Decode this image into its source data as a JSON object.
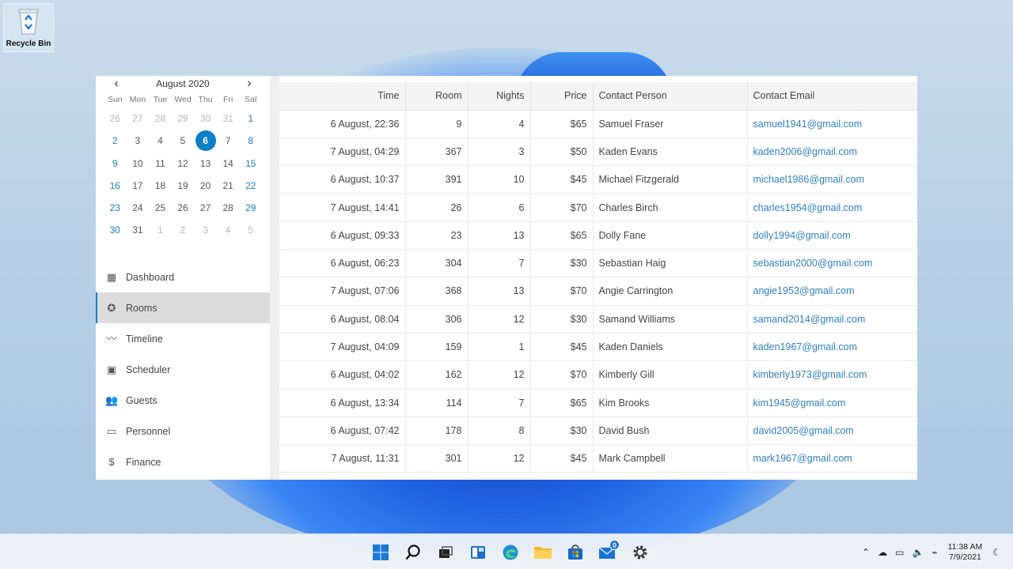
{
  "desktop": {
    "recycle_bin_label": "Recycle Bin"
  },
  "calendar": {
    "month_label": "August 2020",
    "weekdays": [
      "Sun",
      "Mon",
      "Tue",
      "Wed",
      "Thu",
      "Fri",
      "Sat"
    ],
    "weeks": [
      [
        [
          "26",
          "other"
        ],
        [
          "27",
          "other"
        ],
        [
          "28",
          "other"
        ],
        [
          "29",
          "other"
        ],
        [
          "30",
          "other"
        ],
        [
          "31",
          "other"
        ],
        [
          "1",
          "weekend"
        ]
      ],
      [
        [
          "2",
          "weekend"
        ],
        [
          "3",
          ""
        ],
        [
          "4",
          ""
        ],
        [
          "5",
          ""
        ],
        [
          "6",
          "sel"
        ],
        [
          "7",
          ""
        ],
        [
          "8",
          "weekend"
        ]
      ],
      [
        [
          "9",
          "weekend"
        ],
        [
          "10",
          ""
        ],
        [
          "11",
          ""
        ],
        [
          "12",
          ""
        ],
        [
          "13",
          ""
        ],
        [
          "14",
          ""
        ],
        [
          "15",
          "weekend"
        ]
      ],
      [
        [
          "16",
          "weekend"
        ],
        [
          "17",
          ""
        ],
        [
          "18",
          ""
        ],
        [
          "19",
          ""
        ],
        [
          "20",
          ""
        ],
        [
          "21",
          ""
        ],
        [
          "22",
          "weekend"
        ]
      ],
      [
        [
          "23",
          "weekend"
        ],
        [
          "24",
          ""
        ],
        [
          "25",
          ""
        ],
        [
          "26",
          ""
        ],
        [
          "27",
          ""
        ],
        [
          "28",
          ""
        ],
        [
          "29",
          "weekend"
        ]
      ],
      [
        [
          "30",
          "weekend"
        ],
        [
          "31",
          ""
        ],
        [
          "1",
          "other"
        ],
        [
          "2",
          "other"
        ],
        [
          "3",
          "other"
        ],
        [
          "4",
          "other"
        ],
        [
          "5",
          "other"
        ]
      ]
    ]
  },
  "menu": [
    {
      "label": "Dashboard",
      "icon": "dashboard-icon",
      "glyph": "▦"
    },
    {
      "label": "Rooms",
      "icon": "rooms-icon",
      "glyph": "✪",
      "active": true
    },
    {
      "label": "Timeline",
      "icon": "timeline-icon",
      "glyph": "〰"
    },
    {
      "label": "Scheduler",
      "icon": "scheduler-icon",
      "glyph": "▣"
    },
    {
      "label": "Guests",
      "icon": "guests-icon",
      "glyph": "👥"
    },
    {
      "label": "Personnel",
      "icon": "personnel-icon",
      "glyph": "▭"
    },
    {
      "label": "Finance",
      "icon": "finance-icon",
      "glyph": "$"
    }
  ],
  "table": {
    "headers": [
      "Time",
      "Room",
      "Nights",
      "Price",
      "Contact Person",
      "Contact Email"
    ],
    "rows": [
      [
        "6 August, 22:36",
        "9",
        "4",
        "$65",
        "Samuel Fraser",
        "samuel1941@gmail.com"
      ],
      [
        "7 August, 04:29",
        "367",
        "3",
        "$50",
        "Kaden Evans",
        "kaden2006@gmail.com"
      ],
      [
        "6 August, 10:37",
        "391",
        "10",
        "$45",
        "Michael Fitzgerald",
        "michael1986@gmail.com"
      ],
      [
        "7 August, 14:41",
        "26",
        "6",
        "$70",
        "Charles Birch",
        "charles1954@gmail.com"
      ],
      [
        "6 August, 09:33",
        "23",
        "13",
        "$65",
        "Dolly Fane",
        "dolly1994@gmail.com"
      ],
      [
        "6 August, 06:23",
        "304",
        "7",
        "$30",
        "Sebastian Haig",
        "sebastian2000@gmail.com"
      ],
      [
        "7 August, 07:06",
        "368",
        "13",
        "$70",
        "Angie Carrington",
        "angie1953@gmail.com"
      ],
      [
        "6 August, 08:04",
        "306",
        "12",
        "$30",
        "Samand Williams",
        "samand2014@gmail.com"
      ],
      [
        "7 August, 04:09",
        "159",
        "1",
        "$45",
        "Kaden Daniels",
        "kaden1967@gmail.com"
      ],
      [
        "6 August, 04:02",
        "162",
        "12",
        "$70",
        "Kimberly Gill",
        "kimberly1973@gmail.com"
      ],
      [
        "6 August, 13:34",
        "114",
        "7",
        "$65",
        "Kim Brooks",
        "kim1945@gmail.com"
      ],
      [
        "6 August, 07:42",
        "178",
        "8",
        "$30",
        "David Bush",
        "david2005@gmail.com"
      ],
      [
        "7 August, 11:31",
        "301",
        "12",
        "$45",
        "Mark Campbell",
        "mark1967@gmail.com"
      ]
    ]
  },
  "taskbar": {
    "mail_badge": "0",
    "clock_time": "11:38 AM",
    "clock_date": "7/9/2021"
  },
  "colors": {
    "accent": "#0b7fc7",
    "email_link": "#2f7fc1",
    "active_menu_bg": "#dcdcdc"
  }
}
